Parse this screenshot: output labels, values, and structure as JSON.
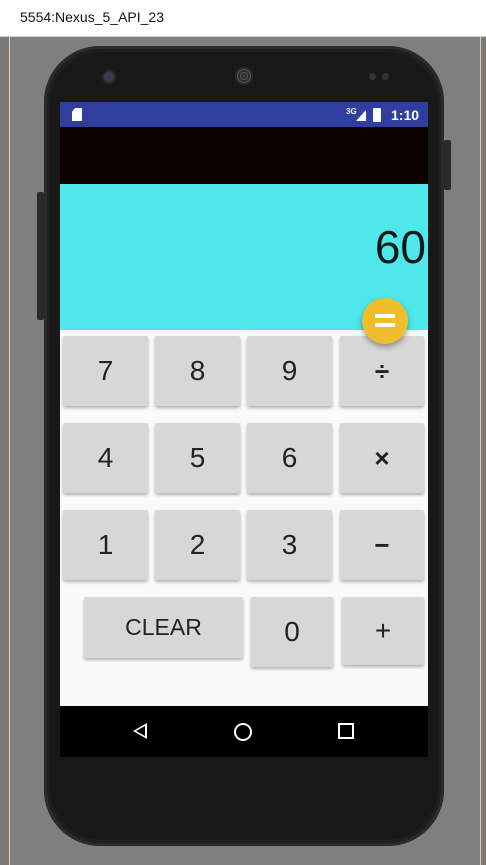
{
  "window": {
    "title": "5554:Nexus_5_API_23"
  },
  "status_bar": {
    "network": "3G",
    "time": "1:10"
  },
  "display": {
    "value": "60"
  },
  "keypad": {
    "row1": [
      "7",
      "8",
      "9",
      "÷"
    ],
    "row2": [
      "4",
      "5",
      "6",
      "×"
    ],
    "row3": [
      "1",
      "2",
      "3",
      "−"
    ],
    "row4": [
      "CLEAR",
      "0",
      "+"
    ]
  },
  "fab": {
    "icon": "equals-icon",
    "color": "#f0bd2f"
  },
  "colors": {
    "display_bg": "#4ee8ea",
    "status_bar": "#303f9f",
    "key_bg": "#d7d7d7"
  }
}
